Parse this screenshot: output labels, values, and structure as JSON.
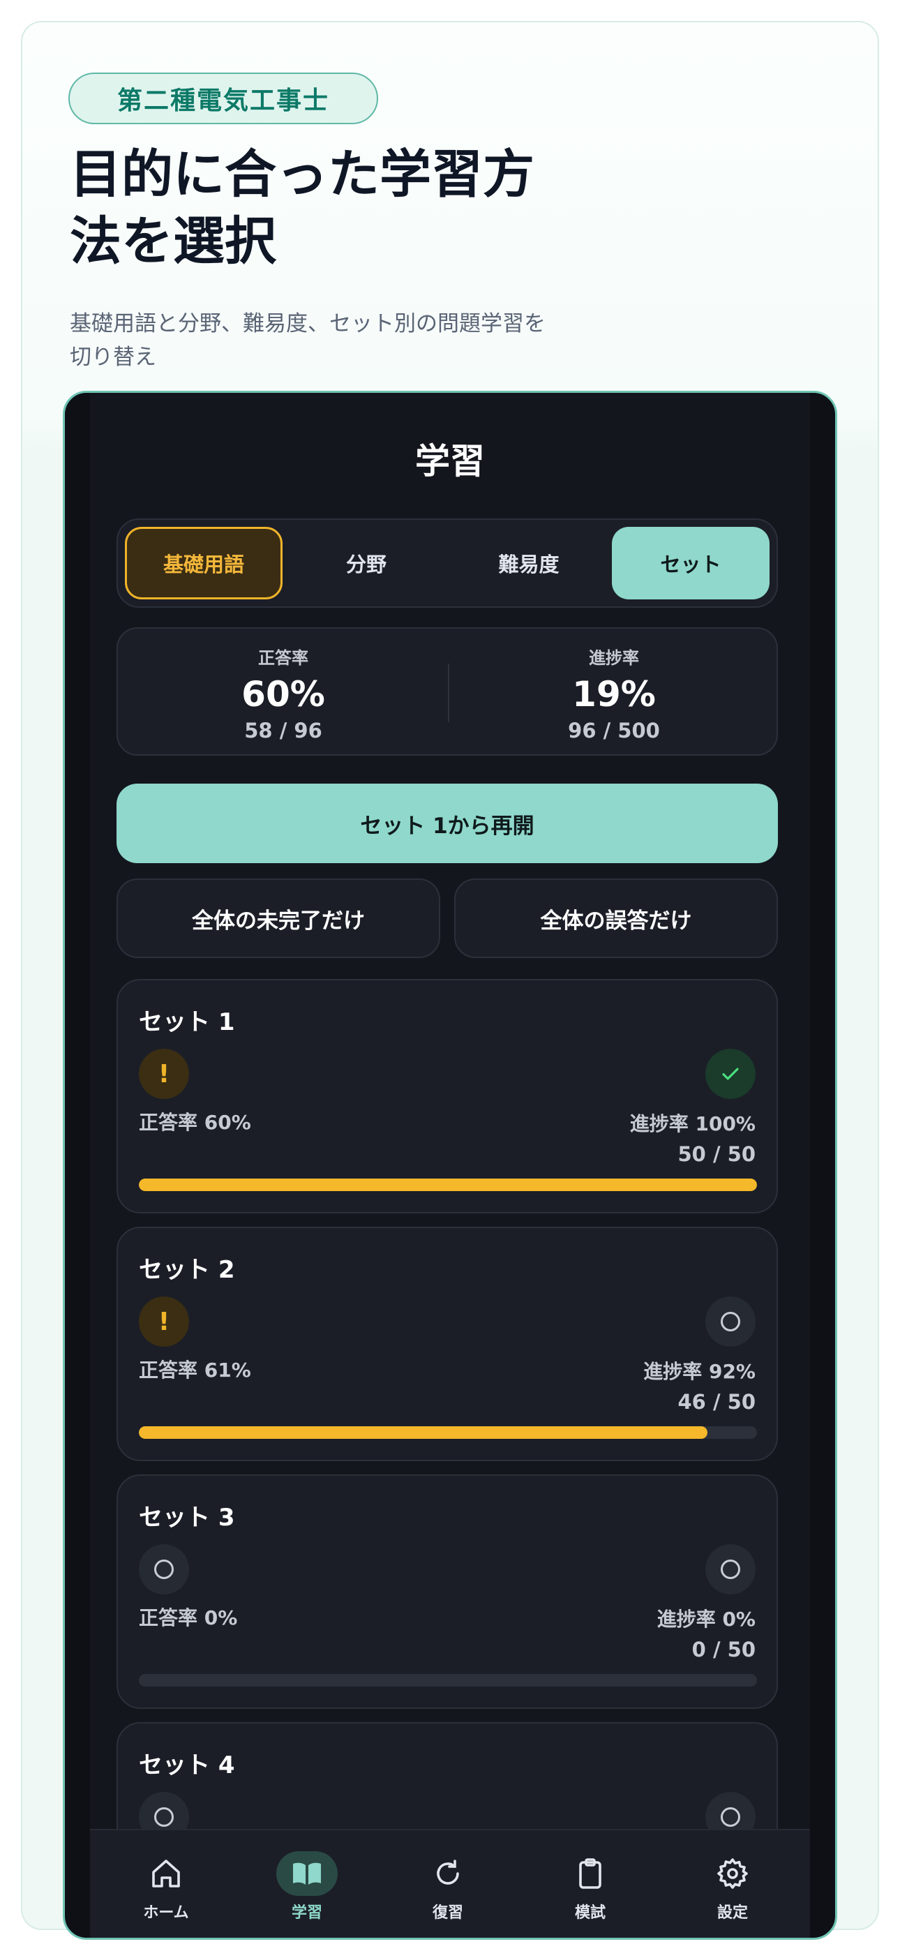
{
  "promo": {
    "badge": "第二種電気工事士",
    "title": "目的に合った学習方法を選択",
    "subtitle": "基礎用語と分野、難易度、セット別の問題学習を切り替え"
  },
  "app": {
    "title": "学習",
    "segments": [
      "基礎用語",
      "分野",
      "難易度",
      "セット"
    ],
    "stats": {
      "accuracy_label": "正答率",
      "accuracy_value": "60%",
      "accuracy_sub": "58 / 96",
      "progress_label": "進捗率",
      "progress_value": "19%",
      "progress_sub": "96 / 500"
    },
    "resume_button": "セット 1から再開",
    "incomplete_button": "全体の未完了だけ",
    "wrong_button": "全体の誤答だけ",
    "sets": [
      {
        "title": "セット 1",
        "accuracy": "正答率 60%",
        "progress": "進捗率 100%",
        "count": "50 / 50",
        "fill": 1.0,
        "left_icon": "warning",
        "right_icon": "check"
      },
      {
        "title": "セット 2",
        "accuracy": "正答率 61%",
        "progress": "進捗率 92%",
        "count": "46 / 50",
        "fill": 0.92,
        "left_icon": "warning",
        "right_icon": "empty"
      },
      {
        "title": "セット 3",
        "accuracy": "正答率 0%",
        "progress": "進捗率 0%",
        "count": "0 / 50",
        "fill": 0.0,
        "left_icon": "empty",
        "right_icon": "empty"
      },
      {
        "title": "セット 4",
        "left_icon": "empty",
        "right_icon": "empty"
      }
    ],
    "tabbar": [
      {
        "label": "ホーム",
        "icon": "home-icon"
      },
      {
        "label": "学習",
        "icon": "book-icon"
      },
      {
        "label": "復習",
        "icon": "refresh-icon"
      },
      {
        "label": "模試",
        "icon": "clipboard-icon"
      },
      {
        "label": "設定",
        "icon": "gear-icon"
      }
    ],
    "colors": {
      "accent": "#8fd8cb",
      "warning": "#f4b82a",
      "success": "#4ade80",
      "background": "#14161d"
    }
  }
}
